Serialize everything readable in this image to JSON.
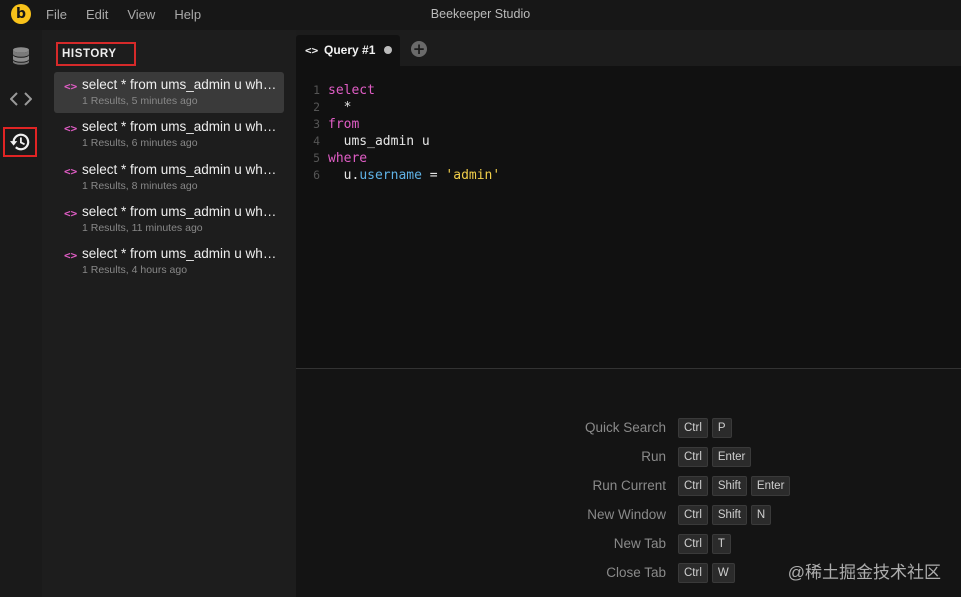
{
  "titlebar": {
    "logo_letter": "b",
    "menu": [
      "File",
      "Edit",
      "View",
      "Help"
    ],
    "app_title": "Beekeeper Studio"
  },
  "activitybar": {
    "items": [
      {
        "icon": "database-icon",
        "active": false
      },
      {
        "icon": "code-icon",
        "active": false
      },
      {
        "icon": "history-icon",
        "active": true
      }
    ]
  },
  "sidebar": {
    "heading": "HISTORY",
    "items": [
      {
        "query": "select * from ums_admin u where u.username = 'admin'",
        "meta": "1 Results, 5 minutes ago",
        "selected": true
      },
      {
        "query": "select * from ums_admin u where u.username = 'admin'",
        "meta": "1 Results, 6 minutes ago",
        "selected": false
      },
      {
        "query": "select * from ums_admin u where u.username = 'admin'",
        "meta": "1 Results, 8 minutes ago",
        "selected": false
      },
      {
        "query": "select * from ums_admin u where u.username = 'admin'",
        "meta": "1 Results, 11 minutes ago",
        "selected": false
      },
      {
        "query": "select * from ums_admin u where u.username = 'admin'",
        "meta": "1 Results, 4 hours ago",
        "selected": false
      }
    ],
    "item_icon": "<>"
  },
  "tabs": {
    "items": [
      {
        "title": "Query #1",
        "icon": "<>",
        "unsaved": true
      }
    ],
    "add_label": "+"
  },
  "editor": {
    "lines": [
      {
        "num": "1",
        "tokens": [
          {
            "t": "select",
            "c": "kw"
          }
        ]
      },
      {
        "num": "2",
        "tokens": [
          {
            "t": "  *",
            "c": ""
          }
        ]
      },
      {
        "num": "3",
        "tokens": [
          {
            "t": "from",
            "c": "kw"
          }
        ]
      },
      {
        "num": "4",
        "tokens": [
          {
            "t": "  ums_admin u",
            "c": ""
          }
        ]
      },
      {
        "num": "5",
        "tokens": [
          {
            "t": "where",
            "c": "kw"
          }
        ]
      },
      {
        "num": "6",
        "tokens": [
          {
            "t": "  u.",
            "c": ""
          },
          {
            "t": "username",
            "c": "prop"
          },
          {
            "t": " = ",
            "c": ""
          },
          {
            "t": "'admin'",
            "c": "str"
          }
        ]
      }
    ]
  },
  "shortcuts": [
    {
      "label": "Quick Search",
      "keys": [
        "Ctrl",
        "P"
      ]
    },
    {
      "label": "Run",
      "keys": [
        "Ctrl",
        "Enter"
      ]
    },
    {
      "label": "Run Current",
      "keys": [
        "Ctrl",
        "Shift",
        "Enter"
      ]
    },
    {
      "label": "New Window",
      "keys": [
        "Ctrl",
        "Shift",
        "N"
      ]
    },
    {
      "label": "New Tab",
      "keys": [
        "Ctrl",
        "T"
      ]
    },
    {
      "label": "Close Tab",
      "keys": [
        "Ctrl",
        "W"
      ]
    }
  ],
  "watermark": "@稀土掘金技术社区",
  "colors": {
    "accent_pink": "#e05dc5",
    "highlight_red": "#d62a2a",
    "logo_yellow": "#f8c21a"
  }
}
